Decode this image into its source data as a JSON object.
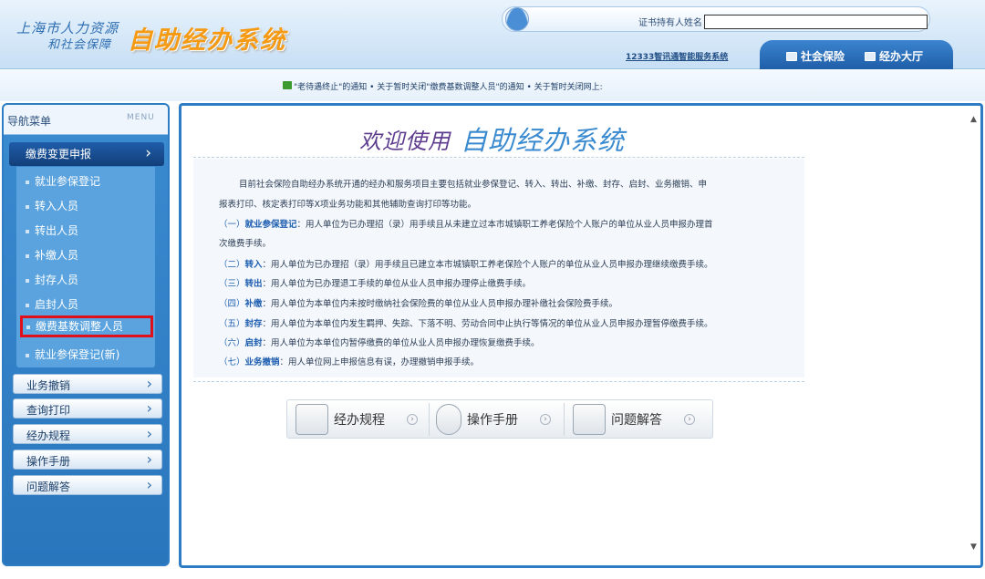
{
  "header": {
    "logo_line1": "上海市人力资源",
    "logo_line2": "和社会保障",
    "logo_title": "自助经办系统",
    "holder_label": "证书持有人姓名",
    "service_link": "12333智讯通智能服务系统",
    "tabs": [
      "社会保险",
      "经办大厅"
    ]
  },
  "notice": {
    "text": "\"老待遇终止\"的通知  • 关于暂时关闭\"缴费基数调整人员\"的通知  • 关于暂时关闭网上:"
  },
  "sidebar": {
    "title": "导航菜单",
    "menu_label": "MENU",
    "active_group": "缴费变更申报",
    "sub_items": [
      "就业参保登记",
      "转入人员",
      "转出人员",
      "补缴人员",
      "封存人员",
      "启封人员",
      "缴费基数调整人员",
      "就业参保登记(新)"
    ],
    "groups": [
      "业务撤销",
      "查询打印",
      "经办规程",
      "操作手册",
      "问题解答"
    ]
  },
  "main": {
    "welcome_prefix": "欢迎使用",
    "welcome_title": "自助经办系统",
    "intro_line1": "目前社会保险自助经办系统开通的经办和服务项目主要包括就业参保登记、转入、转出、补缴、封存、启封、业务撤销、申",
    "intro_line2": "报表打印、核定表打印等X项业务功能和其他辅助查询打印等功能。",
    "items": [
      {
        "num": "（一）",
        "kw": "就业参保登记",
        "text": "：用人单位为已办理招（录）用手续且从未建立过本市城镇职工养老保险个人账户的单位从业人员申报办理首",
        "text2": "次缴费手续。"
      },
      {
        "num": "（二）",
        "kw": "转入",
        "text": "：用人单位为已办理招（录）用手续且已建立本市城镇职工养老保险个人账户的单位从业人员申报办理继续缴费手续。"
      },
      {
        "num": "（三）",
        "kw": "转出",
        "text": "：用人单位为已办理退工手续的单位从业人员申报办理停止缴费手续。"
      },
      {
        "num": "（四）",
        "kw": "补缴",
        "text": "：用人单位为本单位内未按时缴纳社会保险费的单位从业人员申报办理补缴社会保险费手续。"
      },
      {
        "num": "（五）",
        "kw": "封存",
        "text": "：用人单位为本单位内发生羁押、失踪、下落不明、劳动合同中止执行等情况的单位从业人员申报办理暂停缴费手续。"
      },
      {
        "num": "（六）",
        "kw": "启封",
        "text": "：用人单位为本单位内暂停缴费的单位从业人员申报办理恢复缴费手续。"
      },
      {
        "num": "（七）",
        "kw": "业务撤销",
        "text": "：用人单位网上申报信息有误，办理撤销申报手续。"
      }
    ],
    "buttons": [
      "经办规程",
      "操作手册",
      "问题解答"
    ]
  }
}
